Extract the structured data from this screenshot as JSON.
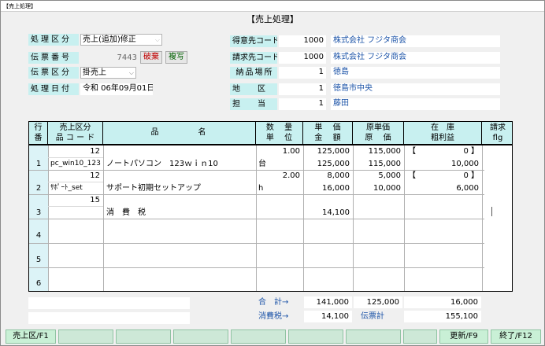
{
  "window": {
    "title": "【売上処理】"
  },
  "screen": {
    "title": "【売上処理】"
  },
  "header": {
    "process_type": {
      "label": "処理区分",
      "value": "売上(追加)修正"
    },
    "slip_no": {
      "label": "伝票番号",
      "value": "7443",
      "discard_label": "破棄",
      "copy_label": "複写"
    },
    "slip_type": {
      "label": "伝票区分",
      "value": "掛売上"
    },
    "process_date": {
      "label": "処理日付",
      "value": "令和 06年09月01日"
    },
    "customer": {
      "label": "得意先コード",
      "code": "1000",
      "name": "株式会社 フジタ商会"
    },
    "billing": {
      "label": "請求先コード",
      "code": "1000",
      "name": "株式会社 フジタ商会"
    },
    "delivery": {
      "label": "納品場所",
      "code": "1",
      "name": "徳島"
    },
    "area": {
      "label": "地区",
      "code": "1",
      "name": "徳島市中央"
    },
    "staff": {
      "label": "担当",
      "code": "1",
      "name": "藤田"
    }
  },
  "grid": {
    "headers": {
      "line_top": "行",
      "line_bottom": "番",
      "code_top": "売上区分",
      "code_bottom": "品 コ ー ド",
      "name": "品名",
      "qty_top": "数　 量",
      "qty_bottom": "単　 位",
      "price_top": "単　 価",
      "price_bottom": "金　 額",
      "cost_top": "原単価",
      "cost_bottom": "原　 価",
      "stock_top": "在　庫",
      "stock_bottom": "粗利益",
      "flag_top": "請求",
      "flag_bottom": "flg"
    },
    "rows": [
      {
        "no": "1",
        "kubun": "12",
        "code": "pc_win10_123",
        "name": "ノートパソコン　123ｗｉｎ10",
        "qty": "1.00",
        "unit": "台",
        "price": "125,000",
        "amount": "125,000",
        "unit_cost": "115,000",
        "cost": "115,000",
        "stock_open": "【",
        "stock": "0 】",
        "gross_profit": "10,000"
      },
      {
        "no": "2",
        "kubun": "12",
        "code": "ｻﾎﾟｰﾄ_set",
        "name": "サポート初期セットアップ",
        "qty": "2.00",
        "unit": "h",
        "price": "8,000",
        "amount": "16,000",
        "unit_cost": "5,000",
        "cost": "10,000",
        "stock_open": "【",
        "stock": "0 】",
        "gross_profit": "6,000"
      },
      {
        "no": "3",
        "kubun": "15",
        "code": "",
        "name": "消　費　税",
        "qty": "",
        "unit": "",
        "price": "",
        "amount": "14,100",
        "unit_cost": "",
        "cost": "",
        "stock_open": "",
        "stock": "",
        "gross_profit": ""
      },
      {
        "no": "4"
      },
      {
        "no": "5"
      },
      {
        "no": "6"
      }
    ]
  },
  "totals": {
    "sum_label": "合　計→",
    "sum_amount": "141,000",
    "sum_cost": "125,000",
    "sum_profit": "16,000",
    "tax_label": "消費税→",
    "tax_amount": "14,100",
    "slip_total_label": "伝票計",
    "slip_total": "155,100"
  },
  "fkeys": {
    "f1": "売上区/F1",
    "f9": "更新/F9",
    "f12": "終了/F12"
  },
  "colors": {
    "label_bg": "#c8f0f0",
    "fkey_bg": "#c9f0d6",
    "discard": "#c00000",
    "copy": "#006000",
    "total_label": "#1d54a8"
  },
  "icons": {
    "dropdown": "chevron-down-icon"
  }
}
